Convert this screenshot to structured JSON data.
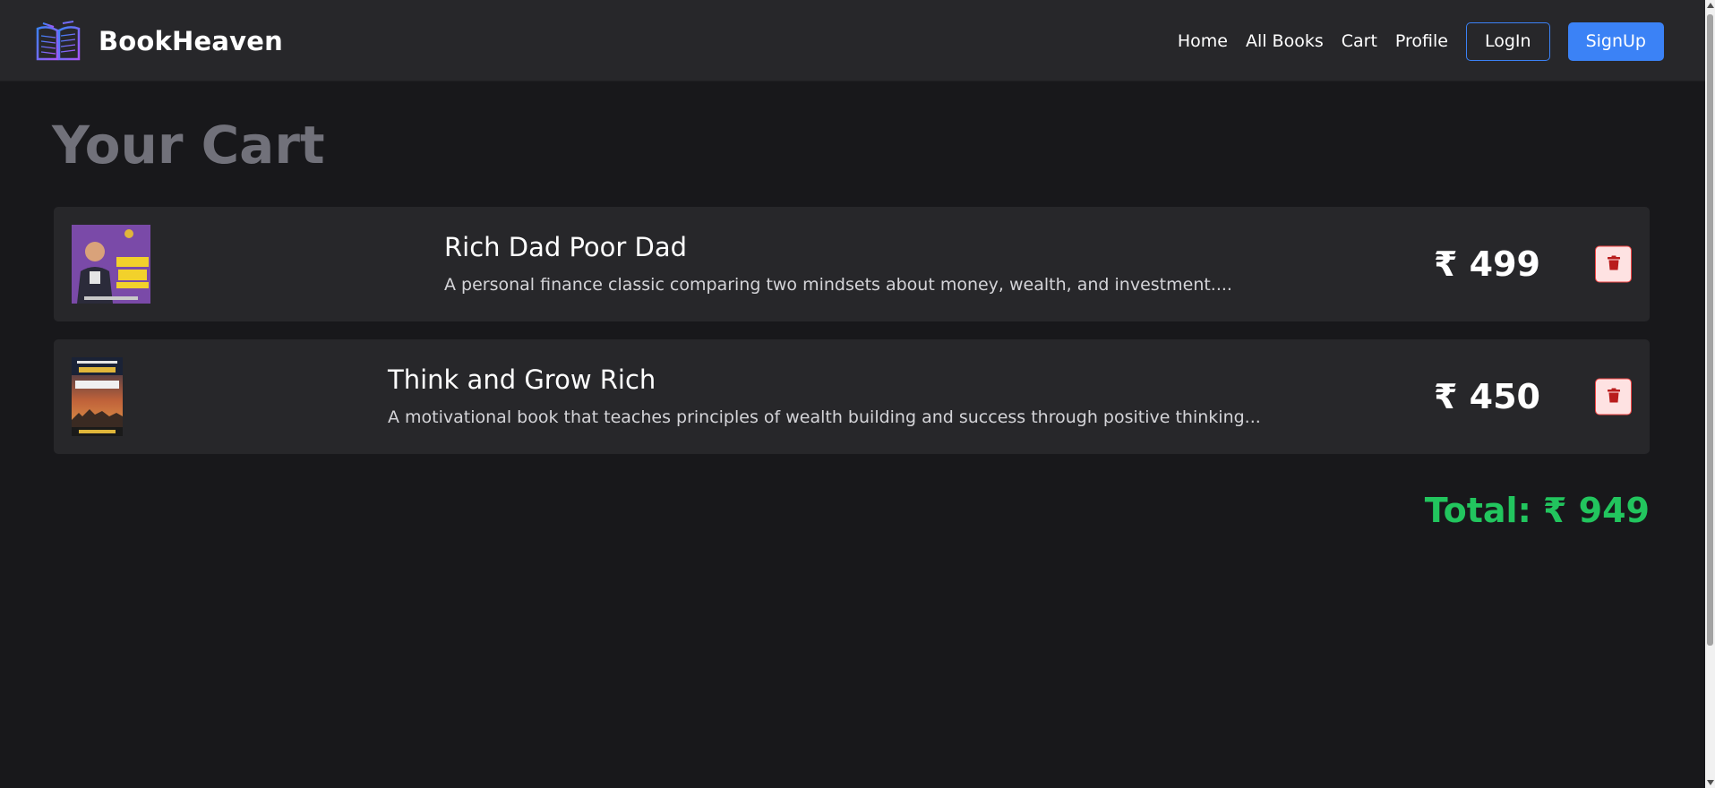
{
  "brand": {
    "name": "BookHeaven",
    "icon": "open-book-icon"
  },
  "nav": {
    "links": [
      "Home",
      "All Books",
      "Cart",
      "Profile"
    ],
    "login_label": "LogIn",
    "signup_label": "SignUp"
  },
  "page_title": "Your Cart",
  "cart": {
    "items": [
      {
        "title": "Rich Dad Poor Dad",
        "description": "A personal finance classic comparing two mindsets about money, wealth, and investment....",
        "price": "₹ 499",
        "cover_icon": "book-cover-rich-dad-poor-dad"
      },
      {
        "title": "Think and Grow Rich",
        "description": "A motivational book that teaches principles of wealth building and success through positive thinking...",
        "price": "₹ 450",
        "cover_icon": "book-cover-think-and-grow-rich"
      }
    ],
    "delete_icon": "trash-icon",
    "total": "Total: ₹ 949"
  },
  "colors": {
    "background": "#18181b",
    "navbar": "#27272a",
    "card": "#27272a",
    "accent": "#3b82f6",
    "total": "#22c55e",
    "danger": "#ef4444"
  }
}
